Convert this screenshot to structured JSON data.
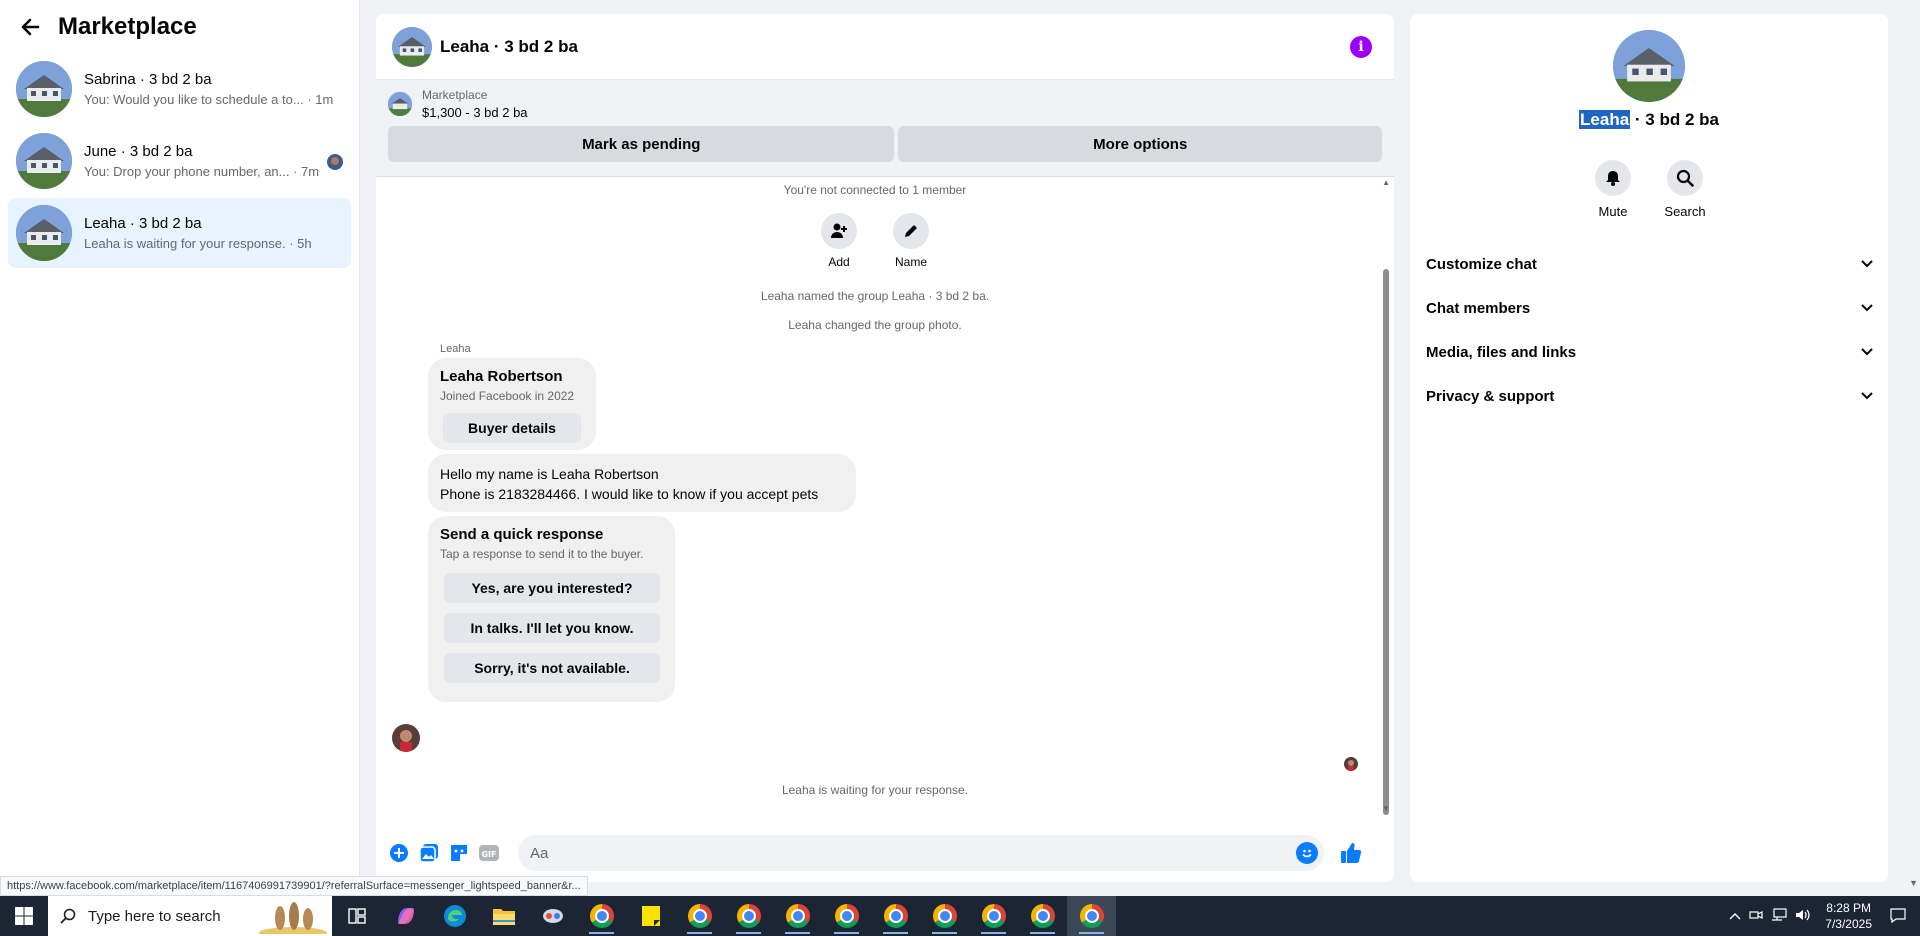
{
  "sidebar": {
    "title": "Marketplace",
    "conversations": [
      {
        "name": "Sabrina · 3 bd 2 ba",
        "snippet": "You: Would you like to schedule a to...",
        "time": " · 1m"
      },
      {
        "name": "June · 3 bd 2 ba",
        "snippet": "You: Drop your phone number, an...",
        "time": " · 7m"
      },
      {
        "name": "Leaha · 3 bd 2 ba",
        "snippet": "Leaha is waiting for your response.",
        "time": " · 5h"
      }
    ]
  },
  "chat": {
    "title": "Leaha · 3 bd 2 ba",
    "listing": {
      "source": "Marketplace",
      "title": "$1,300 - 3 bd 2 ba",
      "mark_pending": "Mark as pending",
      "more_options": "More options"
    },
    "not_connected": "You're not connected to 1 member",
    "add_label": "Add",
    "name_label": "Name",
    "event_named": "Leaha named the group Leaha · 3 bd 2 ba.",
    "event_photo": "Leaha changed the group photo.",
    "sender": "Leaha",
    "profile_card": {
      "name": "Leaha Robertson",
      "joined": "Joined Facebook in 2022",
      "button": "Buyer details"
    },
    "message_line1": "Hello my name is Leaha Robertson",
    "message_line2": "Phone is 2183284466. I would like to know if you accept pets",
    "quick": {
      "title": "Send a quick response",
      "subtitle": "Tap a response to send it to the buyer.",
      "options": [
        "Yes, are you interested?",
        "In talks. I'll let you know.",
        "Sorry, it's not available."
      ]
    },
    "waiting": "Leaha is waiting for your response.",
    "composer_placeholder": "Aa"
  },
  "details": {
    "name_highlight": "Leaha",
    "name_rest": " · 3 bd 2 ba",
    "mute": "Mute",
    "search": "Search",
    "sections": [
      "Customize chat",
      "Chat members",
      "Media, files and links",
      "Privacy & support"
    ]
  },
  "status_url": "https://www.facebook.com/marketplace/item/1167406991739901/?referralSurface=messenger_lightspeed_banner&r...",
  "taskbar": {
    "search_placeholder": "Type here to search",
    "time": "8:28 PM",
    "date": "7/3/2025"
  },
  "colors": {
    "accent": "#0a7cff",
    "info": "#9b00fa",
    "active_row": "#e7f3ff"
  }
}
